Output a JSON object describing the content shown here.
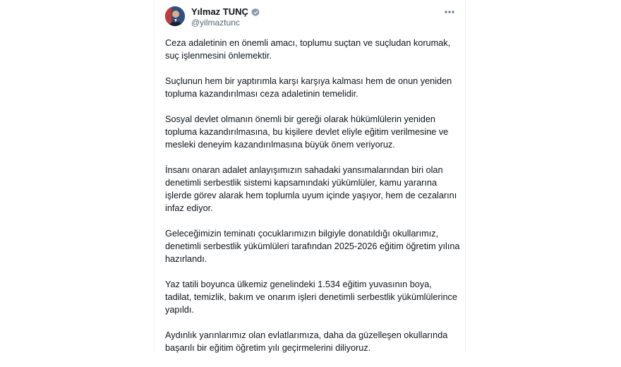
{
  "post": {
    "author": {
      "display_name": "Yılmaz TUNÇ",
      "handle": "@yilmaztunc",
      "verified": true,
      "verified_color": "#829aab"
    },
    "more_icon": "more-horizontal-icon",
    "paragraphs": [
      "Ceza adaletinin en önemli amacı, toplumu suçtan ve suçludan korumak, suç işlenmesini önlemektir.",
      "Suçlunun hem bir yaptırımla karşı karşıya kalması hem de onun yeniden topluma kazandırılması ceza adaletinin temelidir.",
      "Sosyal devlet olmanın önemli bir gereği olarak hükümlülerin yeniden topluma kazandırılmasına, bu kişilere devlet eliyle eğitim verilmesine ve mesleki deneyim kazandırılmasına büyük önem veriyoruz.",
      "İnsanı onaran adalet anlayışımızın sahadaki yansımalarından biri olan denetimli serbestlik sistemi kapsamındaki yükümlüler, kamu yararına işlerde görev alarak hem toplumla uyum içinde yaşıyor, hem de cezalarını infaz ediyor.",
      "Geleceğimizin teminatı çocuklarımızın bilgiyle donatıldığı okullarımız, denetimli serbestlik yükümlüleri tarafından 2025-2026 eğitim öğretim yılına hazırlandı.",
      "Yaz tatili boyunca ülkemiz genelindeki 1.534 eğitim yuvasının boya, tadilat, temizlik, bakım ve onarım işleri denetimli serbestlik yükümlülerince yapıldı.",
      "Aydınlık yarınlarımız olan evlatlarımıza, daha da güzelleşen okullarında başarılı bir eğitim öğretim yılı geçirmelerini diliyoruz."
    ]
  },
  "colors": {
    "text": "#0f1419",
    "secondary": "#536471"
  }
}
